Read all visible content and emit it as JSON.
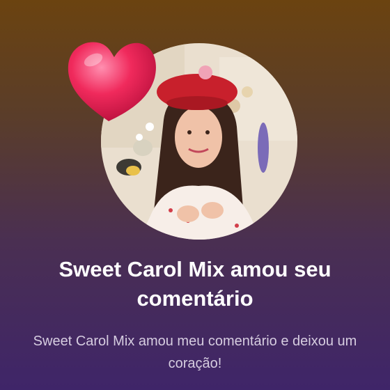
{
  "notification": {
    "title": "Sweet Carol Mix amou seu comentário",
    "message": "Sweet Carol Mix amou meu comentário e deixou um coração!",
    "avatar_icon": "profile-photo",
    "reaction_icon": "heart-icon"
  },
  "colors": {
    "background_top": "#6b4310",
    "background_bottom": "#3f2569",
    "heart": "#e8245a",
    "title_text": "#ffffff",
    "message_text": "#d6cde0"
  }
}
